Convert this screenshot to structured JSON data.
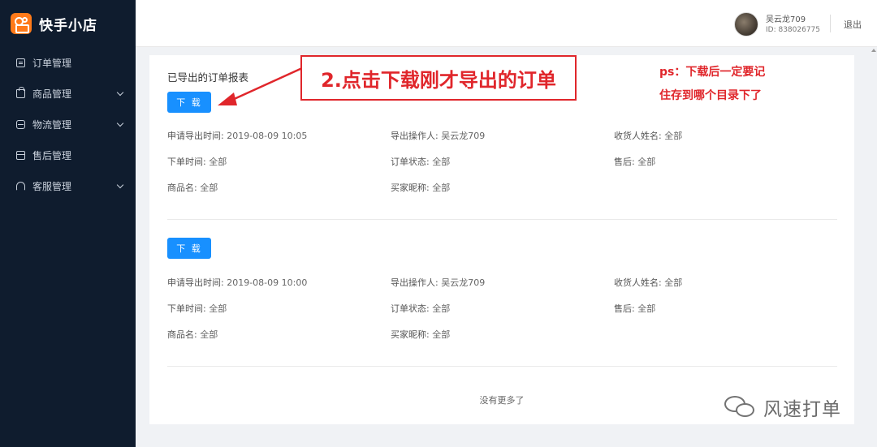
{
  "app": {
    "name": "快手小店"
  },
  "sidebar": {
    "items": [
      {
        "label": "订单管理",
        "icon": "list-icon",
        "expandable": false
      },
      {
        "label": "商品管理",
        "icon": "bag-icon",
        "expandable": true
      },
      {
        "label": "物流管理",
        "icon": "truck-icon",
        "expandable": true
      },
      {
        "label": "售后管理",
        "icon": "box-icon",
        "expandable": false
      },
      {
        "label": "客服管理",
        "icon": "headset-icon",
        "expandable": true
      }
    ]
  },
  "header": {
    "user_name": "吴云龙709",
    "user_id": "ID: 838026775",
    "logout_label": "退出"
  },
  "main": {
    "title": "已导出的订单报表",
    "download_label": "下 载",
    "records": [
      {
        "export_time_label": "申请导出时间:",
        "export_time": "2019-08-09 10:05",
        "operator_label": "导出操作人:",
        "operator": "吴云龙709",
        "receiver_label": "收货人姓名:",
        "receiver": "全部",
        "order_time_label": "下单时间:",
        "order_time": "全部",
        "order_status_label": "订单状态:",
        "order_status": "全部",
        "after_sale_label": "售后:",
        "after_sale": "全部",
        "product_label": "商品名:",
        "product": "全部",
        "buyer_label": "买家昵称:",
        "buyer": "全部"
      },
      {
        "export_time_label": "申请导出时间:",
        "export_time": "2019-08-09 10:00",
        "operator_label": "导出操作人:",
        "operator": "吴云龙709",
        "receiver_label": "收货人姓名:",
        "receiver": "全部",
        "order_time_label": "下单时间:",
        "order_time": "全部",
        "order_status_label": "订单状态:",
        "order_status": "全部",
        "after_sale_label": "售后:",
        "after_sale": "全部",
        "product_label": "商品名:",
        "product": "全部",
        "buyer_label": "买家昵称:",
        "buyer": "全部"
      }
    ],
    "no_more": "没有更多了"
  },
  "annotation": {
    "step": "2.点击下载刚才导出的订单",
    "note_line1": "ps：下载后一定要记",
    "note_line2": "住存到哪个目录下了"
  },
  "watermark": {
    "text": "风速打单"
  },
  "colors": {
    "sidebar_bg": "#0f1c2e",
    "brand_orange": "#ff7a19",
    "primary": "#1890ff",
    "annotation_red": "#e0262b"
  }
}
